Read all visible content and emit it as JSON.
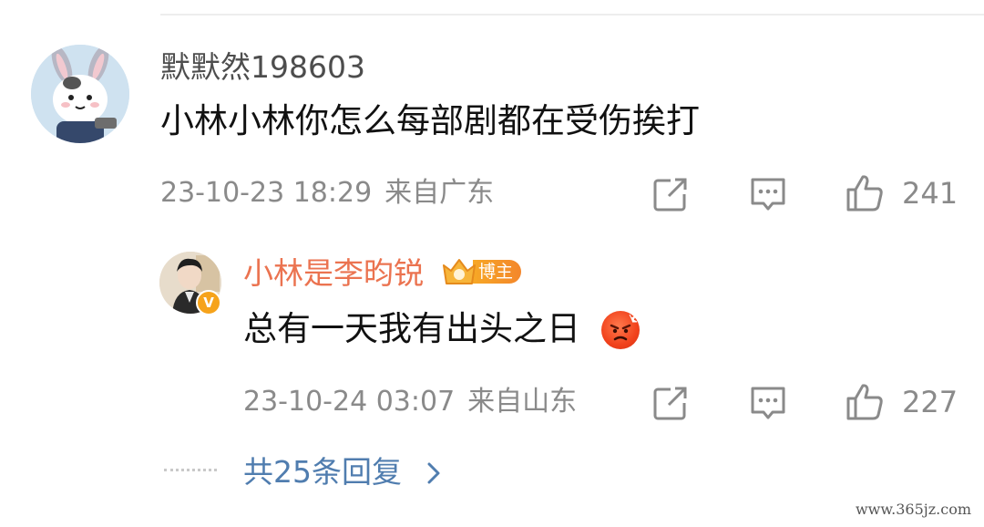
{
  "comment": {
    "username": "默默然198603",
    "text": "小林小林你怎么每部剧都在受伤挨打",
    "time": "23-10-23 18:29",
    "location": "来自广东",
    "likes": "241"
  },
  "reply": {
    "username": "小林是李昀锐",
    "badge_label": "博主",
    "verified_mark": "V",
    "text": "总有一天我有出头之日",
    "emoji": "angry-face",
    "time": "23-10-24 03:07",
    "location": "来自山东",
    "likes": "227"
  },
  "replies_link": "共25条回复",
  "watermark": "www.365jz.com",
  "colors": {
    "username_reply": "#eb7350",
    "link": "#507daf",
    "meta": "#8a8a8a",
    "badge": "#f6a31b"
  }
}
